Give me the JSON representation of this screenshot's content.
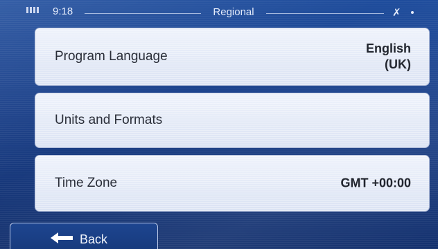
{
  "status_bar": {
    "signal_icon": "signal-icon",
    "time": "9:18",
    "title": "Regional",
    "gps_icon": "gps-satellite-icon"
  },
  "settings": [
    {
      "label": "Program Language",
      "value_lines": [
        "English",
        "(UK)"
      ]
    },
    {
      "label": "Units and Formats",
      "value_lines": []
    },
    {
      "label": "Time Zone",
      "value_lines": [
        "GMT +00:00"
      ]
    }
  ],
  "back_button": {
    "label": "Back",
    "icon": "back-arrow-icon"
  },
  "colors": {
    "background": "#1b3e82",
    "row": "#e6ebf7",
    "text": "#2a2e39"
  }
}
